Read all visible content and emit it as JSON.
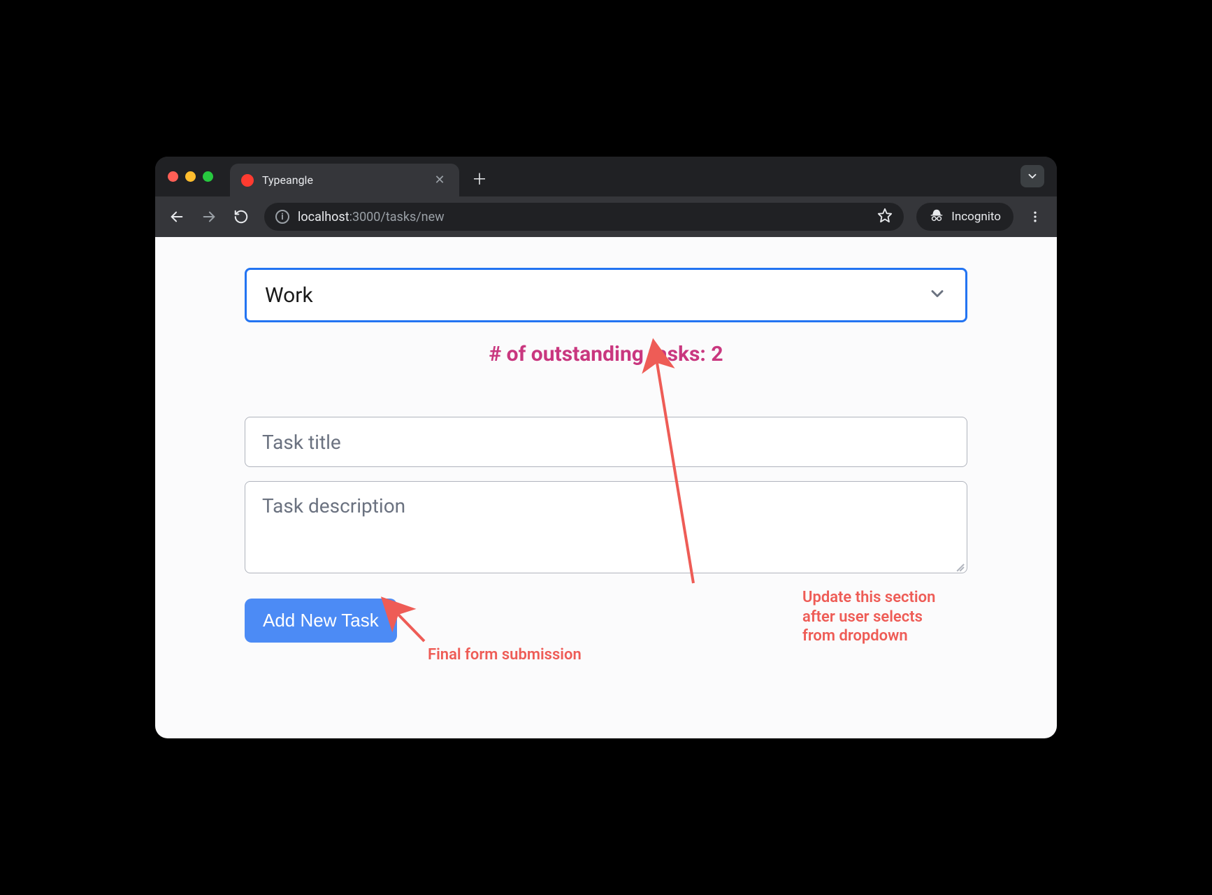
{
  "browser": {
    "tab_title": "Typeangle",
    "url_host": "localhost",
    "url_port": ":3000",
    "url_path": "/tasks/new",
    "incognito_label": "Incognito"
  },
  "form": {
    "category_selected": "Work",
    "outstanding_label": "# of outstanding tasks: 2",
    "title_placeholder": "Task title",
    "description_placeholder": "Task description",
    "submit_label": "Add New Task"
  },
  "annotations": {
    "update_note_line1": "Update this section",
    "update_note_line2": "after user selects",
    "update_note_line3": "from dropdown",
    "submission_note": "Final form submission"
  }
}
